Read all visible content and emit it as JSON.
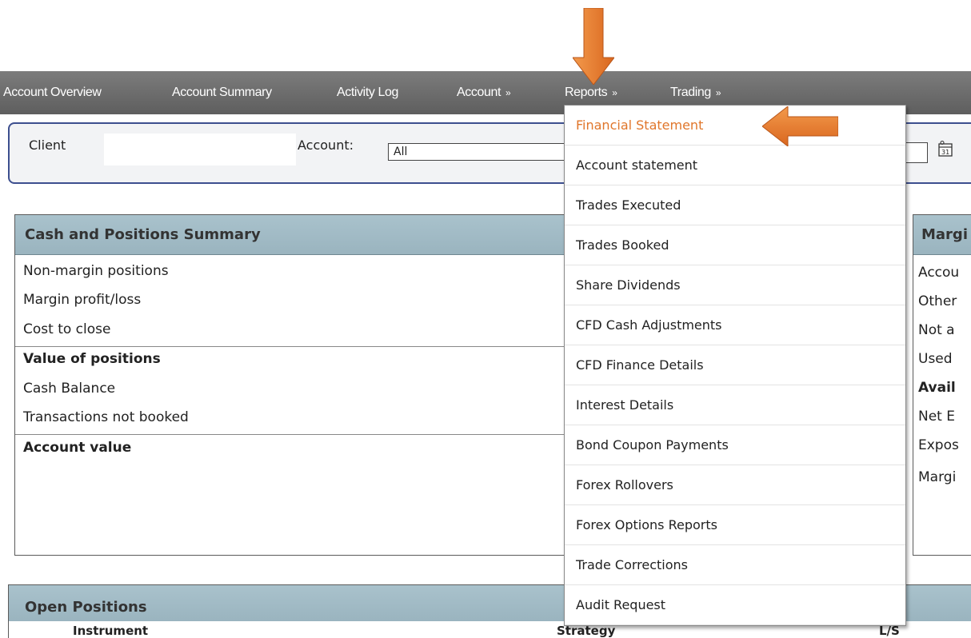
{
  "nav": {
    "items": [
      {
        "label": "Account Overview",
        "chevron": ""
      },
      {
        "label": "Account Summary",
        "chevron": ""
      },
      {
        "label": "Activity Log",
        "chevron": ""
      },
      {
        "label": "Account",
        "chevron": "»"
      },
      {
        "label": "Reports",
        "chevron": "»"
      },
      {
        "label": "Trading",
        "chevron": "»"
      }
    ]
  },
  "client_bar": {
    "client_label": "Client",
    "account_label": "Account:",
    "account_value": "All",
    "calendar_icon_text": "31"
  },
  "cash_panel": {
    "title": "Cash and Positions Summary",
    "rows": [
      "Non-margin positions",
      "Margin profit/loss",
      "Cost to close",
      "Value of positions",
      "Cash Balance",
      "Transactions not booked",
      "Account value"
    ]
  },
  "margin_panel": {
    "title": "Margi",
    "rows": [
      "Accou",
      "Other",
      "Not a",
      "Used",
      "Avail",
      "Net E",
      "Expos",
      "Margi"
    ]
  },
  "open_positions": {
    "title": "Open Positions",
    "columns": [
      "Instrument",
      "Strategy",
      "L/S"
    ]
  },
  "reports_menu": {
    "items": [
      "Financial Statement",
      "Account statement",
      "Trades Executed",
      "Trades Booked",
      "Share Dividends",
      "CFD Cash Adjustments",
      "CFD Finance Details",
      "Interest Details",
      "Bond Coupon Payments",
      "Forex Rollovers",
      "Forex Options Reports",
      "Trade Corrections",
      "Audit Request"
    ]
  },
  "colors": {
    "nav_bg": "#6b6b6b",
    "panel_header": "#a3bcc6",
    "accent_orange": "#e0762b",
    "client_border": "#3d4f8f"
  }
}
